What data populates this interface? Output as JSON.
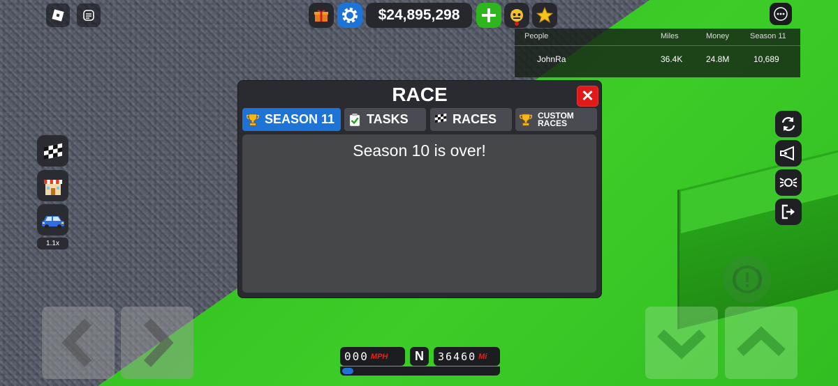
{
  "top_bar": {
    "money": "$24,895,298"
  },
  "leaderboard": {
    "headers": {
      "people": "People",
      "miles": "Miles",
      "money": "Money",
      "season": "Season 11"
    },
    "rows": [
      {
        "name": "JohnRa",
        "miles": "36.4K",
        "money": "24.8M",
        "season": "10,689"
      }
    ]
  },
  "race_panel": {
    "title": "RACE",
    "close": "✕",
    "tabs": [
      {
        "label": "SEASON 11",
        "icon": "trophy-icon",
        "active": true
      },
      {
        "label": "TASKS",
        "icon": "clipboard-icon",
        "active": false
      },
      {
        "label": "RACES",
        "icon": "checkered-flag-icon",
        "active": false
      },
      {
        "label": "CUSTOM\nRACES",
        "icon": "trophy-icon",
        "active": false
      }
    ],
    "message": "Season 10 is over!"
  },
  "left_sidebar": {
    "multiplier": "1.1x"
  },
  "hud": {
    "speed": "000",
    "speed_unit": "MPH",
    "gear": "N",
    "miles": "36460",
    "miles_unit": "Mi",
    "progress": 0.07
  },
  "colors": {
    "accent_blue": "#1e73d6",
    "close_red": "#e01919",
    "plus_green": "#2fb51d",
    "star_yellow": "#f5c518"
  }
}
